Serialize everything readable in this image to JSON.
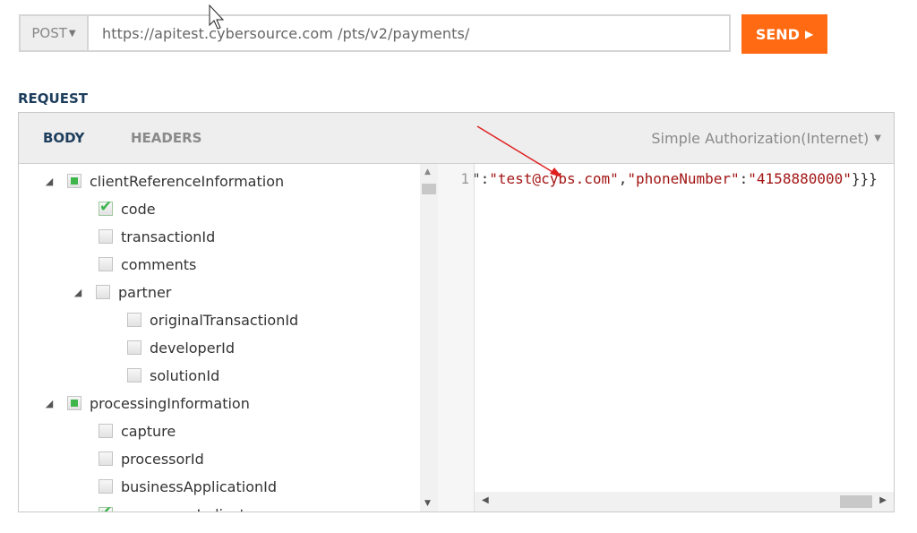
{
  "request_bar": {
    "method": "POST",
    "url": "https://apitest.cybersource.com /pts/v2/payments/",
    "send_label": "SEND"
  },
  "section_label": "REQUEST",
  "tabs": [
    {
      "label": "BODY",
      "active": true
    },
    {
      "label": "HEADERS",
      "active": false
    }
  ],
  "auth_dropdown": "Simple Authorization(Internet)",
  "tree": [
    {
      "label": "clientReferenceInformation",
      "state": "partial",
      "expandable": true
    },
    {
      "label": "code",
      "state": "checked",
      "expandable": false
    },
    {
      "label": "transactionId",
      "state": "unchecked",
      "expandable": false
    },
    {
      "label": "comments",
      "state": "unchecked",
      "expandable": false
    },
    {
      "label": "partner",
      "state": "unchecked",
      "expandable": true
    },
    {
      "label": "originalTransactionId",
      "state": "unchecked",
      "expandable": false
    },
    {
      "label": "developerId",
      "state": "unchecked",
      "expandable": false
    },
    {
      "label": "solutionId",
      "state": "unchecked",
      "expandable": false
    },
    {
      "label": "processingInformation",
      "state": "partial",
      "expandable": true
    },
    {
      "label": "capture",
      "state": "unchecked",
      "expandable": false
    },
    {
      "label": "processorId",
      "state": "unchecked",
      "expandable": false
    },
    {
      "label": "businessApplicationId",
      "state": "unchecked",
      "expandable": false
    },
    {
      "label": "commerceIndicator",
      "state": "checked",
      "expandable": false
    }
  ],
  "editor": {
    "line_number": "1",
    "code_parts": [
      {
        "text": "\":",
        "kind": "p"
      },
      {
        "text": "\"test@cybs.com\"",
        "kind": "s"
      },
      {
        "text": ",",
        "kind": "p"
      },
      {
        "text": "\"phoneNumber\"",
        "kind": "s"
      },
      {
        "text": ":",
        "kind": "p"
      },
      {
        "text": "\"4158880000\"",
        "kind": "s"
      },
      {
        "text": "}}}",
        "kind": "p"
      }
    ]
  },
  "icons": {
    "dropdown": "chevron-down-icon",
    "send": "play-icon",
    "expander": "triangle-down-icon",
    "annotation": "red-arrow",
    "cursor": "mouse-pointer-icon"
  },
  "colors": {
    "accent": "#ff6a13",
    "checkbox_green": "#3fb64a",
    "string_red": "#a31515",
    "heading_navy": "#1d3d5c"
  }
}
